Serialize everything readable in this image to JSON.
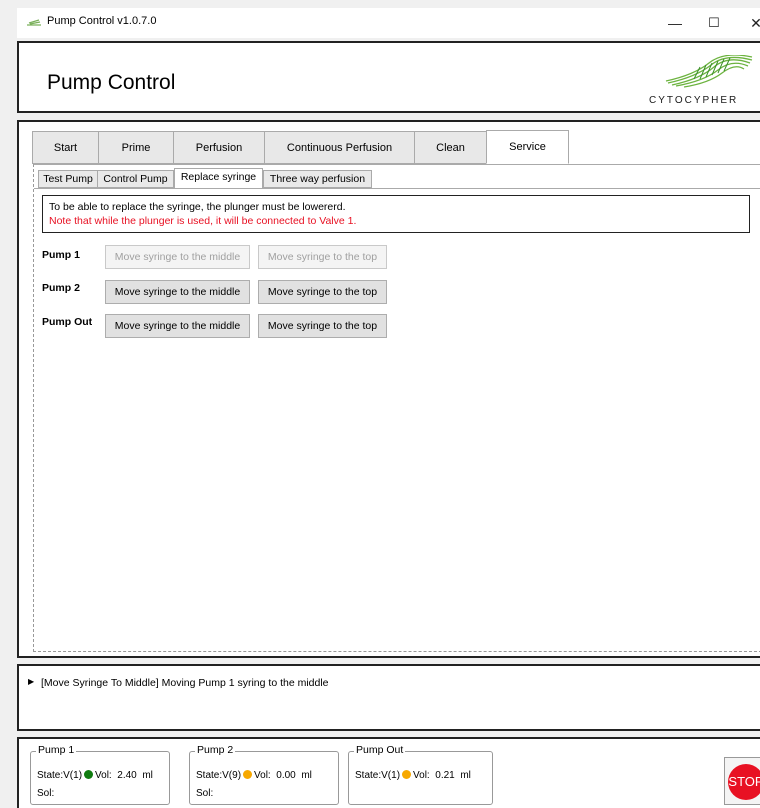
{
  "window": {
    "title": "Pump Control v1.0.7.0",
    "minimize": "—",
    "maximize": "☐",
    "close": "✕"
  },
  "header": {
    "title": "Pump Control",
    "logo_text": "CYTOCYPHER"
  },
  "tabs": [
    {
      "label": "Start"
    },
    {
      "label": "Prime"
    },
    {
      "label": "Perfusion"
    },
    {
      "label": "Continuous Perfusion"
    },
    {
      "label": "Clean"
    },
    {
      "label": "Service",
      "active": true
    }
  ],
  "subtabs": [
    {
      "label": "Test Pump"
    },
    {
      "label": "Control Pump"
    },
    {
      "label": "Replace syringe",
      "active": true
    },
    {
      "label": "Three way perfusion"
    }
  ],
  "note": {
    "line1": "To be able to replace the syringe, the plunger must be lowererd.",
    "line2": "Note that while the plunger is used, it will be connected to Valve 1."
  },
  "pumps_rows": [
    {
      "label": "Pump 1",
      "middle": "Move syringe to the middle",
      "top": "Move syringe to the top",
      "enabled": false
    },
    {
      "label": "Pump 2",
      "middle": "Move syringe to the middle",
      "top": "Move syringe to the top",
      "enabled": true
    },
    {
      "label": "Pump Out",
      "middle": "Move syringe to the middle",
      "top": "Move syringe to the top",
      "enabled": true
    }
  ],
  "log": {
    "message": "[Move Syringe To Middle] Moving Pump 1 syring to the middle"
  },
  "status": [
    {
      "title": "Pump 1",
      "state": "State:V(1)",
      "dot_color": "#107c10",
      "vol_label": "Vol:",
      "vol": "2.40",
      "unit": "ml",
      "sol": "Sol:"
    },
    {
      "title": "Pump 2",
      "state": "State:V(9)",
      "dot_color": "#f7a800",
      "vol_label": "Vol:",
      "vol": "0.00",
      "unit": "ml",
      "sol": "Sol:"
    },
    {
      "title": "Pump Out",
      "state": "State:V(1)",
      "dot_color": "#f7a800",
      "vol_label": "Vol:",
      "vol": "0.21",
      "unit": "ml",
      "sol": ""
    }
  ],
  "stop_label": "STOP"
}
